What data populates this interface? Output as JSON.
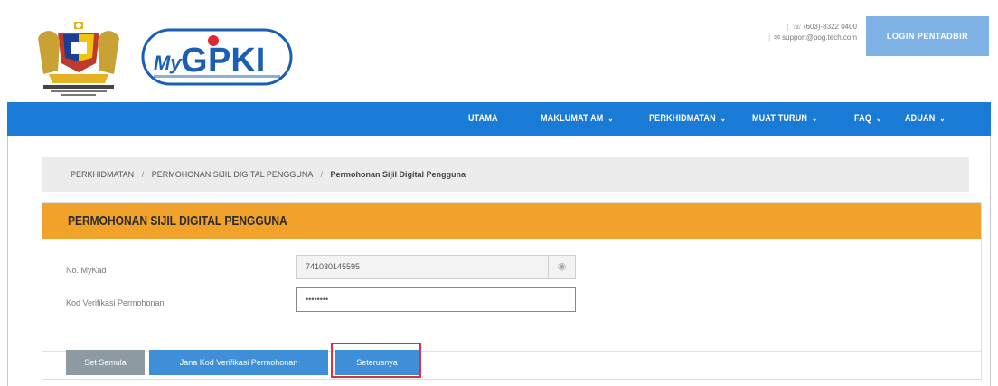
{
  "header": {
    "crest_caption": "",
    "logo_text": "MyGPKI",
    "logo_subtext": "",
    "contact": {
      "phone": "(603)-8322 0400",
      "email": "support@pog.tech.com"
    },
    "login_label": "LOGIN PENTADBIR"
  },
  "nav": {
    "items": [
      {
        "label": "UTAMA",
        "dropdown": false
      },
      {
        "label": "MAKLUMAT AM",
        "dropdown": true
      },
      {
        "label": "PERKHIDMATAN",
        "dropdown": true
      },
      {
        "label": "MUAT TURUN",
        "dropdown": true
      },
      {
        "label": "FAQ",
        "dropdown": true
      },
      {
        "label": "ADUAN",
        "dropdown": true
      }
    ]
  },
  "breadcrumb": {
    "items": [
      "PERKHIDMATAN",
      "PERMOHONAN SIJIL DIGITAL PENGGUNA"
    ],
    "current": "Permohonan Sijil Digital Pengguna",
    "separator": "/"
  },
  "panel": {
    "title": "PERMOHONAN SIJIL DIGITAL PENGGUNA",
    "fields": [
      {
        "label": "No. MyKad",
        "value": "741030145595"
      },
      {
        "label": "Kod Verifikasi Permohonan",
        "value": "••••••••"
      }
    ],
    "buttons": {
      "reset": "Set Semula",
      "generate": "Jana Kod Verifikasi Permohonan",
      "next": "Seterusnya"
    }
  },
  "colors": {
    "nav_bg": "#1a7bd6",
    "panel_head": "#f0a22a",
    "button_primary": "#3f8fd8",
    "button_reset": "#8e9aa1",
    "highlight": "#d9333f",
    "login_bg": "#7fb3e6"
  },
  "icons": {
    "crest": "coat-of-arms-icon",
    "eye": "eye-icon"
  }
}
